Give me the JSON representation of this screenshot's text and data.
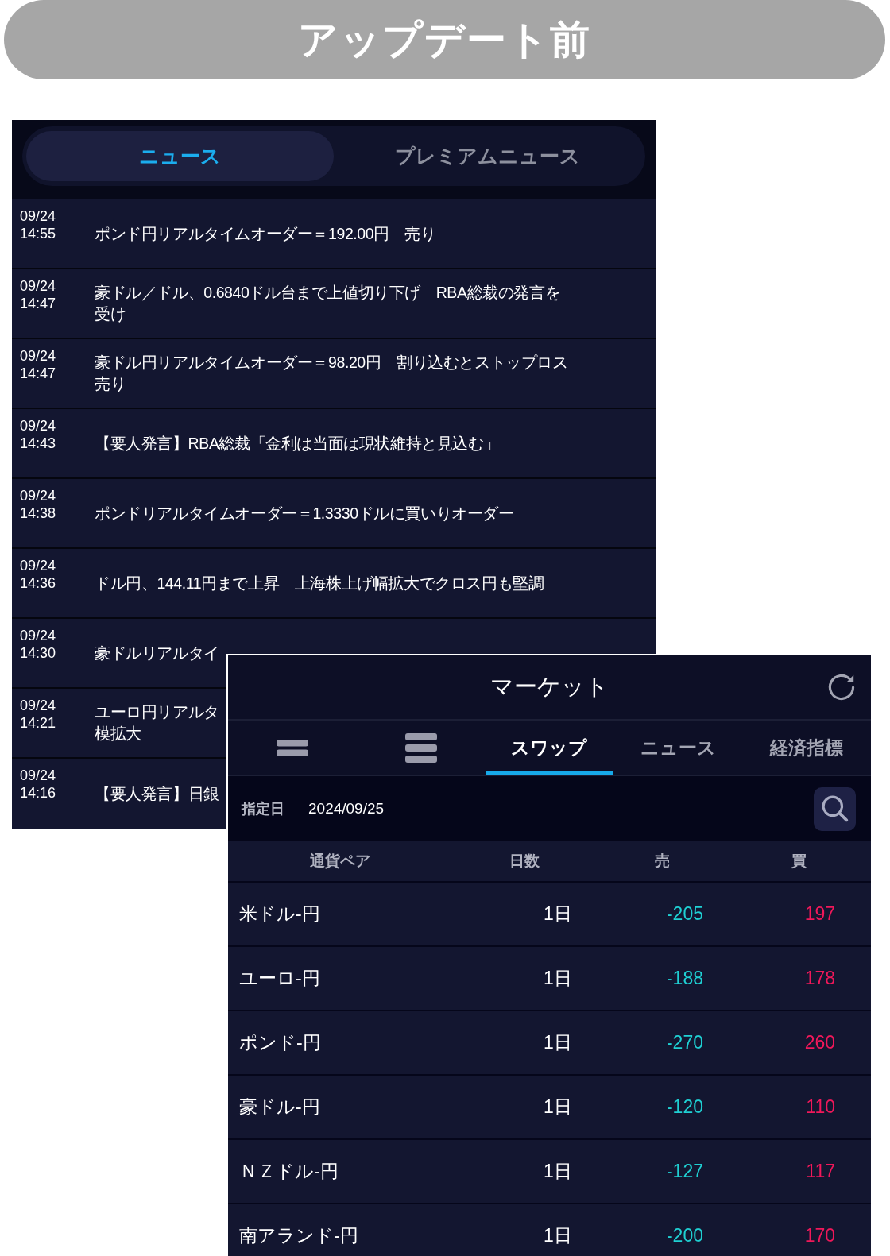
{
  "banner": {
    "title": "アップデート前"
  },
  "news_panel": {
    "tabs": [
      {
        "label": "ニュース",
        "selected": true
      },
      {
        "label": "プレミアムニュース",
        "selected": false
      }
    ],
    "items": [
      {
        "date": "09/24",
        "time": "14:55",
        "headline": "ポンド円リアルタイムオーダー＝192.00円　売り"
      },
      {
        "date": "09/24",
        "time": "14:47",
        "headline": "豪ドル／ドル、0.6840ドル台まで上値切り下げ　RBA総裁の発言を受け"
      },
      {
        "date": "09/24",
        "time": "14:47",
        "headline": "豪ドル円リアルタイムオーダー＝98.20円　割り込むとストップロス売り"
      },
      {
        "date": "09/24",
        "time": "14:43",
        "headline": "【要人発言】RBA総裁「金利は当面は現状維持と見込む」"
      },
      {
        "date": "09/24",
        "time": "14:38",
        "headline": "ポンドリアルタイムオーダー＝1.3330ドルに買いりオーダー"
      },
      {
        "date": "09/24",
        "time": "14:36",
        "headline": "ドル円、144.11円まで上昇　上海株上げ幅拡大でクロス円も堅調"
      },
      {
        "date": "09/24",
        "time": "14:30",
        "headline": "豪ドルリアルタイ"
      },
      {
        "date": "09/24",
        "time": "14:21",
        "headline": "ユーロ円リアルタ",
        "continuation": "模拡大"
      },
      {
        "date": "09/24",
        "time": "14:16",
        "headline": "【要人発言】日銀"
      }
    ]
  },
  "market_panel": {
    "title": "マーケット",
    "tabs": [
      {
        "kind": "compact",
        "selected": false
      },
      {
        "kind": "detailed",
        "selected": false
      },
      {
        "kind": "text",
        "label": "スワップ",
        "selected": true
      },
      {
        "kind": "text",
        "label": "ニュース",
        "selected": false
      },
      {
        "kind": "text",
        "label": "経済指標",
        "selected": false
      }
    ],
    "date_filter": {
      "label": "指定日",
      "value": "2024/09/25"
    },
    "columns": [
      "通貨ペア",
      "日数",
      "売",
      "買"
    ],
    "rows": [
      {
        "pair": "米ドル-円",
        "days": "1日",
        "sell": "-205",
        "buy": "197"
      },
      {
        "pair": "ユーロ-円",
        "days": "1日",
        "sell": "-188",
        "buy": "178"
      },
      {
        "pair": "ポンド-円",
        "days": "1日",
        "sell": "-270",
        "buy": "260"
      },
      {
        "pair": "豪ドル-円",
        "days": "1日",
        "sell": "-120",
        "buy": "110"
      },
      {
        "pair": "ＮＺドル-円",
        "days": "1日",
        "sell": "-127",
        "buy": "117"
      },
      {
        "pair": "南アランド-円",
        "days": "1日",
        "sell": "-200",
        "buy": "170"
      }
    ]
  }
}
